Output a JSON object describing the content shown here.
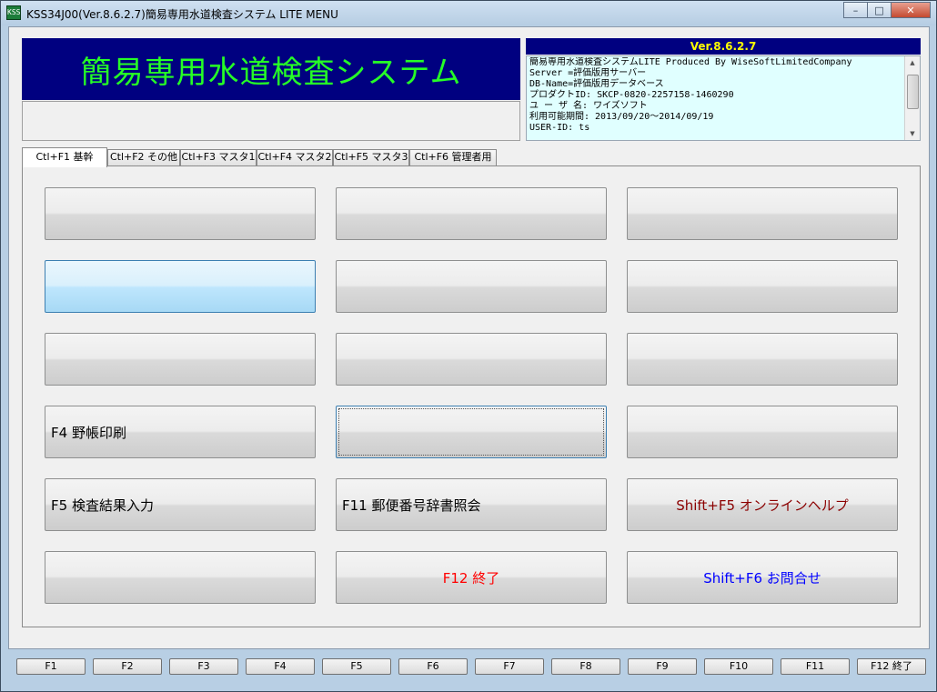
{
  "window": {
    "title": "KSS34J00(Ver.8.6.2.7)簡易専用水道検査システム LITE MENU",
    "app_icon_text": "KSS",
    "minimize_glyph": "–",
    "maximize_glyph": "□",
    "close_glyph": "✕"
  },
  "banner": {
    "title": "簡易専用水道検査システム",
    "title_color": "#26ff26",
    "background": "#000080"
  },
  "info": {
    "version": "Ver.8.6.2.7",
    "lines": [
      "簡易専用水道検査システムLITE Produced By WiseSoftLimitedCompany",
      "Server =評価版用サーバー",
      "DB-Name=評価版用データベース",
      "プロダクトID: SKCP-0820-2257158-1460290",
      "ユ ー ザ 名: ワイズソフト",
      "利用可能期間: 2013/09/20〜2014/09/19",
      "USER-ID: ts"
    ],
    "scroll_up": "▲",
    "scroll_down": "▼"
  },
  "tabs": [
    {
      "label": "Ctl+F1 基幹",
      "active": true
    },
    {
      "label": "Ctl+F2 その他",
      "active": false
    },
    {
      "label": "Ctl+F3 マスタ1",
      "active": false
    },
    {
      "label": "Ctl+F4 マスタ2",
      "active": false
    },
    {
      "label": "Ctl+F5 マスタ3",
      "active": false
    },
    {
      "label": "Ctl+F6 管理者用",
      "active": false
    }
  ],
  "buttons": {
    "r1c1": "",
    "r1c2": "",
    "r1c3": "",
    "r2c1": "",
    "r2c2": "",
    "r2c3": "",
    "r3c1": "",
    "r3c2": "",
    "r3c3": "",
    "r4c1": "F4 野帳印刷",
    "r4c2": "",
    "r4c3": "",
    "r5c1": "F5 検査結果入力",
    "r5c2": "F11 郵便番号辞書照会",
    "r5c3": "Shift+F5 オンラインヘルプ",
    "r6c1": "",
    "r6c2": "F12 終了",
    "r6c3": "Shift+F6 お問合せ"
  },
  "fkeys": [
    "F1",
    "F2",
    "F3",
    "F4",
    "F5",
    "F6",
    "F7",
    "F8",
    "F9",
    "F10",
    "F11",
    "F12 終了"
  ],
  "colors": {
    "exit": "#ff0000",
    "help": "#8b0000",
    "contact": "#0000ff",
    "info_header_text": "#ffff00",
    "info_background": "#e0ffff"
  }
}
